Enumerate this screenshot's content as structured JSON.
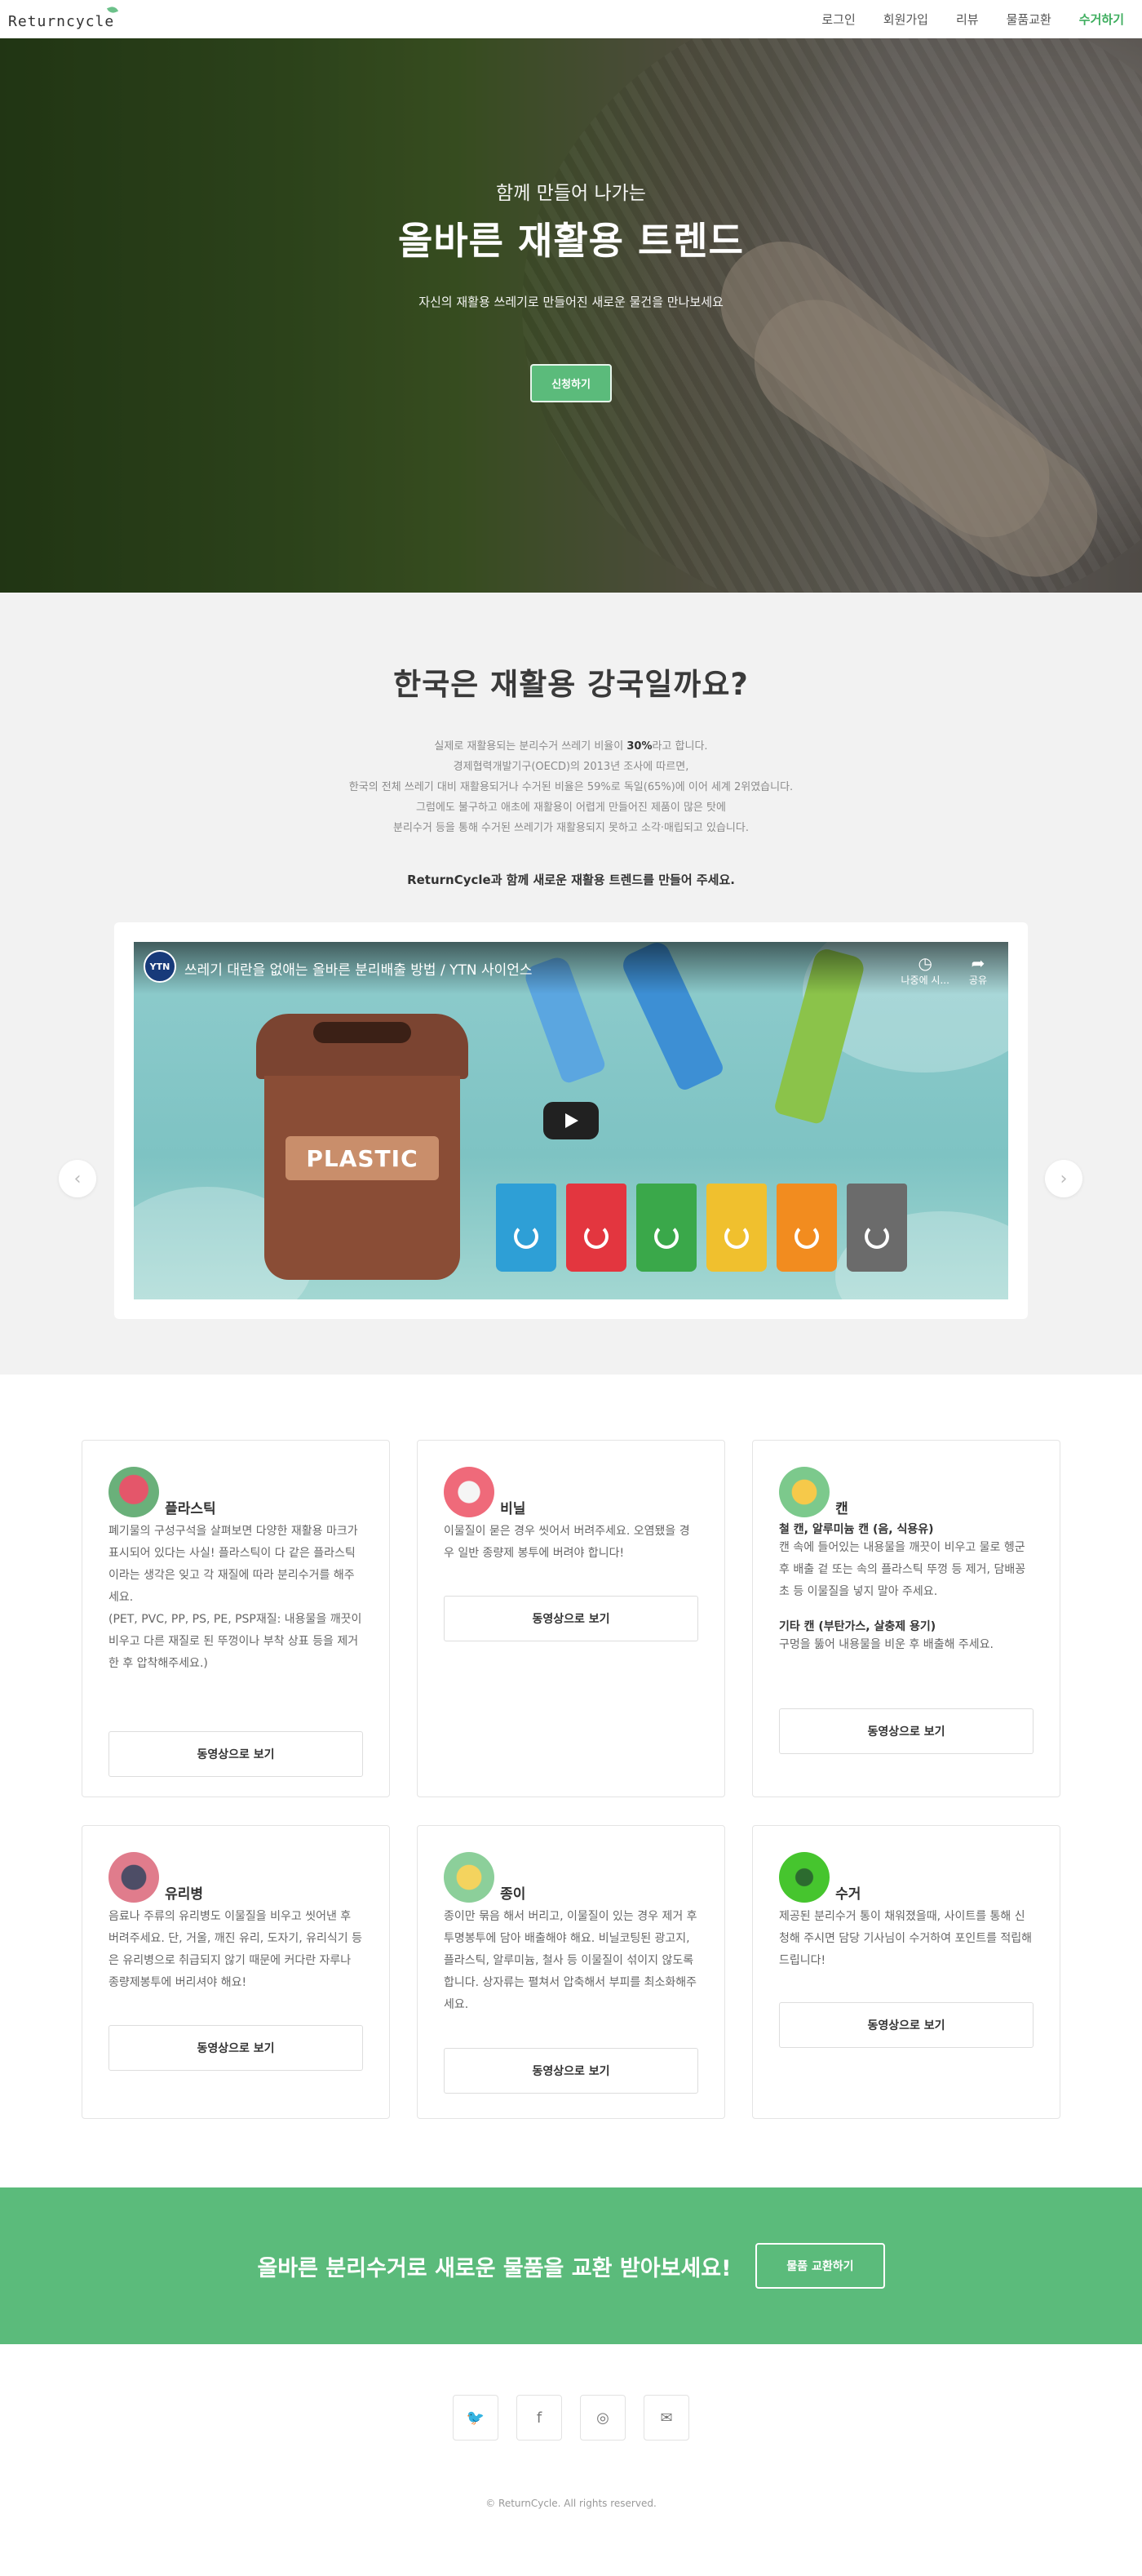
{
  "nav": {
    "logo": "Returncycle",
    "items": [
      {
        "label": "로그인"
      },
      {
        "label": "회원가입"
      },
      {
        "label": "리뷰"
      },
      {
        "label": "물품교환"
      },
      {
        "label": "수거하기"
      }
    ]
  },
  "hero": {
    "kicker": "함께 만들어 나가는",
    "title": "올바른 재활용 트렌드",
    "subtitle": "자신의 재활용 쓰레기로 만들어진 새로운 물건을 만나보세요",
    "cta": "신청하기"
  },
  "intro": {
    "title": "한국은 재활용 강국일까요?",
    "line1_pre": "실제로 재활용되는 분리수거 쓰레기 비율이 ",
    "line1_bold": "30%",
    "line1_post": "라고 합니다.",
    "line2": "경제협력개발기구(OECD)의 2013년 조사에 따르면,",
    "line3": "한국의 전체 쓰레기 대비 재활용되거나 수거된 비율은 59%로 독일(65%)에 이어 세계 2위였습니다.",
    "line4": "그럼에도 불구하고 애초에 재활용이 어렵게 만들어진 제품이 많은 탓에",
    "line5": "분리수거 등을 통해 수거된 쓰레기가 재활용되지 못하고 소각·매립되고 있습니다.",
    "emphasis": "ReturnCycle과 함께 새로운 재활용 트렌드를 만들어 주세요."
  },
  "video": {
    "channel": "YTN",
    "title": "쓰레기 대란을 없애는 올바른 분리배출 방법 / YTN 사이언스",
    "watch_later": "나중에 시...",
    "share": "공유",
    "bin_label": "PLASTIC"
  },
  "cards": [
    {
      "name": "플라스틱",
      "icon": "plastic-icon",
      "text": "폐기물의 구성구석을 살펴보면 다양한 재활용 마크가 표시되어 있다는 사실! 플라스틱이 다 같은 플라스틱이라는 생각은 잊고 각 재질에 따라 분리수거를 해주세요.",
      "text2": "(PET, PVC, PP, PS, PE, PSP재질: 내용물을 깨끗이 비우고 다른 재질로 된 뚜껑이나 부착 상표 등을 제거한 후 압착해주세요.)",
      "button": "동영상으로 보기"
    },
    {
      "name": "비닐",
      "icon": "vinyl-icon",
      "text": "이물질이 묻은 경우 씻어서 버려주세요. 오염됐을 경우 일반 종량제 봉투에 버려야 합니다!",
      "button": "동영상으로 보기"
    },
    {
      "name": "캔",
      "icon": "can-icon",
      "sub1": "철 캔, 알루미늄 캔 (음, 식용유)",
      "text": "캔 속에 들어있는 내용물을 깨끗이 비우고 물로 헹군 후 배출 겉 또는 속의 플라스틱 뚜껑 등 제거, 담배꽁초 등 이물질을 넣지 말아 주세요.",
      "sub2": "기타 캔 (부탄가스, 살충제 용기)",
      "text2": "구멍을 뚫어 내용물을 비운 후 배출해 주세요.",
      "button": "동영상으로 보기"
    },
    {
      "name": "유리병",
      "icon": "glass-icon",
      "text": "음료나 주류의 유리병도 이물질을 비우고 씻어낸 후 버려주세요. 단, 거울, 깨진 유리, 도자기, 유리식기 등은 유리병으로 취급되지 않기 때문에 커다란 자루나 종량제봉투에 버리셔야 해요!",
      "button": "동영상으로 보기"
    },
    {
      "name": "종이",
      "icon": "paper-icon",
      "text": "종이만 묶음 해서 버리고, 이물질이 있는 경우 제거 후 투명봉투에 담아 배출해야 해요. 비닐코팅된 광고지, 플라스틱, 알루미늄, 철사 등 이물질이 섞이지 않도록 합니다. 상자류는 펼쳐서 압축해서 부피를 최소화해주세요.",
      "button": "동영상으로 보기"
    },
    {
      "name": "수거",
      "icon": "collection-icon",
      "text": "제공된 분리수거 통이 채워졌을때, 사이트를 통해 신청해 주시면 담당 기사님이 수거하여 포인트를 적립해드립니다!",
      "button": "동영상으로 보기"
    }
  ],
  "banner": {
    "text": "올바른 분리수거로 새로운 물품을 교환 받아보세요!",
    "button": "물품 교환하기"
  },
  "footer": {
    "socials": [
      {
        "icon": "twitter-icon",
        "glyph": "🐦"
      },
      {
        "icon": "facebook-icon",
        "glyph": "f"
      },
      {
        "icon": "instagram-icon",
        "glyph": "◎"
      },
      {
        "icon": "email-icon",
        "glyph": "✉"
      }
    ],
    "copyright": "© ReturnCycle. All rights reserved."
  },
  "colors": {
    "accent": "#5bbb7b",
    "nav_accent": "#3fae5f",
    "intro_bg": "#f2f2f2"
  }
}
